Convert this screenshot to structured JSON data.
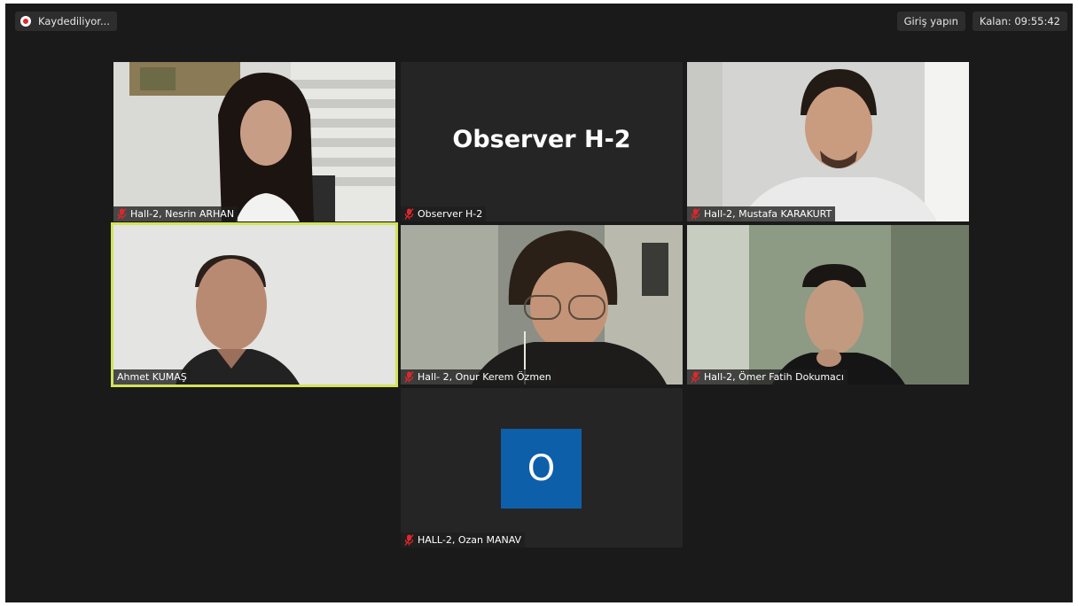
{
  "topbar": {
    "recording_label": "Kaydediliyor...",
    "sign_in_label": "Giriş yapın",
    "remaining_label": "Kalan: 09:55:42"
  },
  "tiles": [
    {
      "label": "Hall-2, Nesrin ARHAN",
      "muted": true,
      "type": "video"
    },
    {
      "label": "Observer H-2",
      "muted": true,
      "type": "name-card",
      "display_name": "Observer H-2"
    },
    {
      "label": "Hall-2, Mustafa KARAKURT",
      "muted": true,
      "type": "video"
    },
    {
      "label": "Ahmet KUMAŞ",
      "muted": false,
      "type": "video",
      "active_speaker": true
    },
    {
      "label": "Hall- 2, Onur Kerem Özmen",
      "muted": true,
      "type": "video"
    },
    {
      "label": "Hall-2, Ömer Fatih Dokumacı",
      "muted": true,
      "type": "video"
    },
    {
      "label": "HALL-2, Ozan MANAV",
      "muted": true,
      "type": "avatar",
      "avatar_letter": "O"
    }
  ],
  "colors": {
    "background": "#1a1a1a",
    "tile_background": "#252525",
    "active_speaker_border": "#d3e35a",
    "avatar_blue": "#0e5faa",
    "muted_icon": "#e0262d"
  },
  "icons": {
    "recording": "record-dot-icon",
    "muted": "mic-off-icon"
  }
}
